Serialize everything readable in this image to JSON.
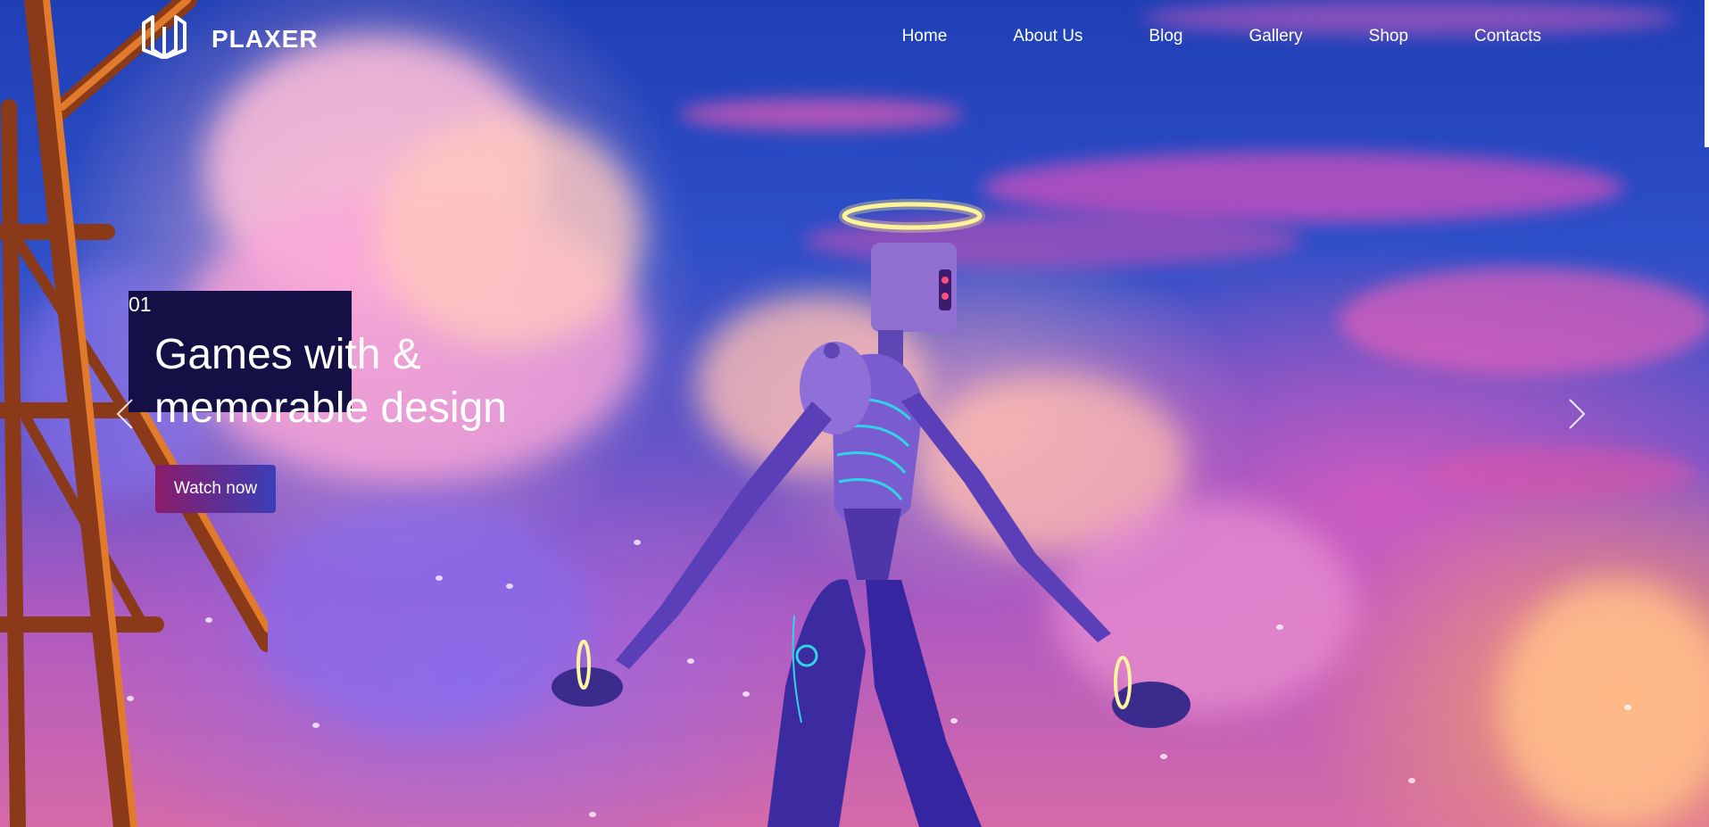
{
  "brand": {
    "name": "PLAXER",
    "logo_icon": "plaxer-logo-icon"
  },
  "nav": {
    "items": [
      {
        "label": "Home"
      },
      {
        "label": "About Us"
      },
      {
        "label": "Blog"
      },
      {
        "label": "Gallery"
      },
      {
        "label": "Shop"
      },
      {
        "label": "Contacts"
      }
    ]
  },
  "slide": {
    "number": "01",
    "title_line1": "Games with &",
    "title_line2": "memorable design",
    "cta_label": "Watch now",
    "prev_icon": "chevron-left-icon",
    "next_icon": "chevron-right-icon"
  },
  "colors": {
    "accent_box": "#140f45",
    "button_start": "#8a1c6a",
    "button_end": "#3b3eb8",
    "halo": "#fff4a0"
  }
}
